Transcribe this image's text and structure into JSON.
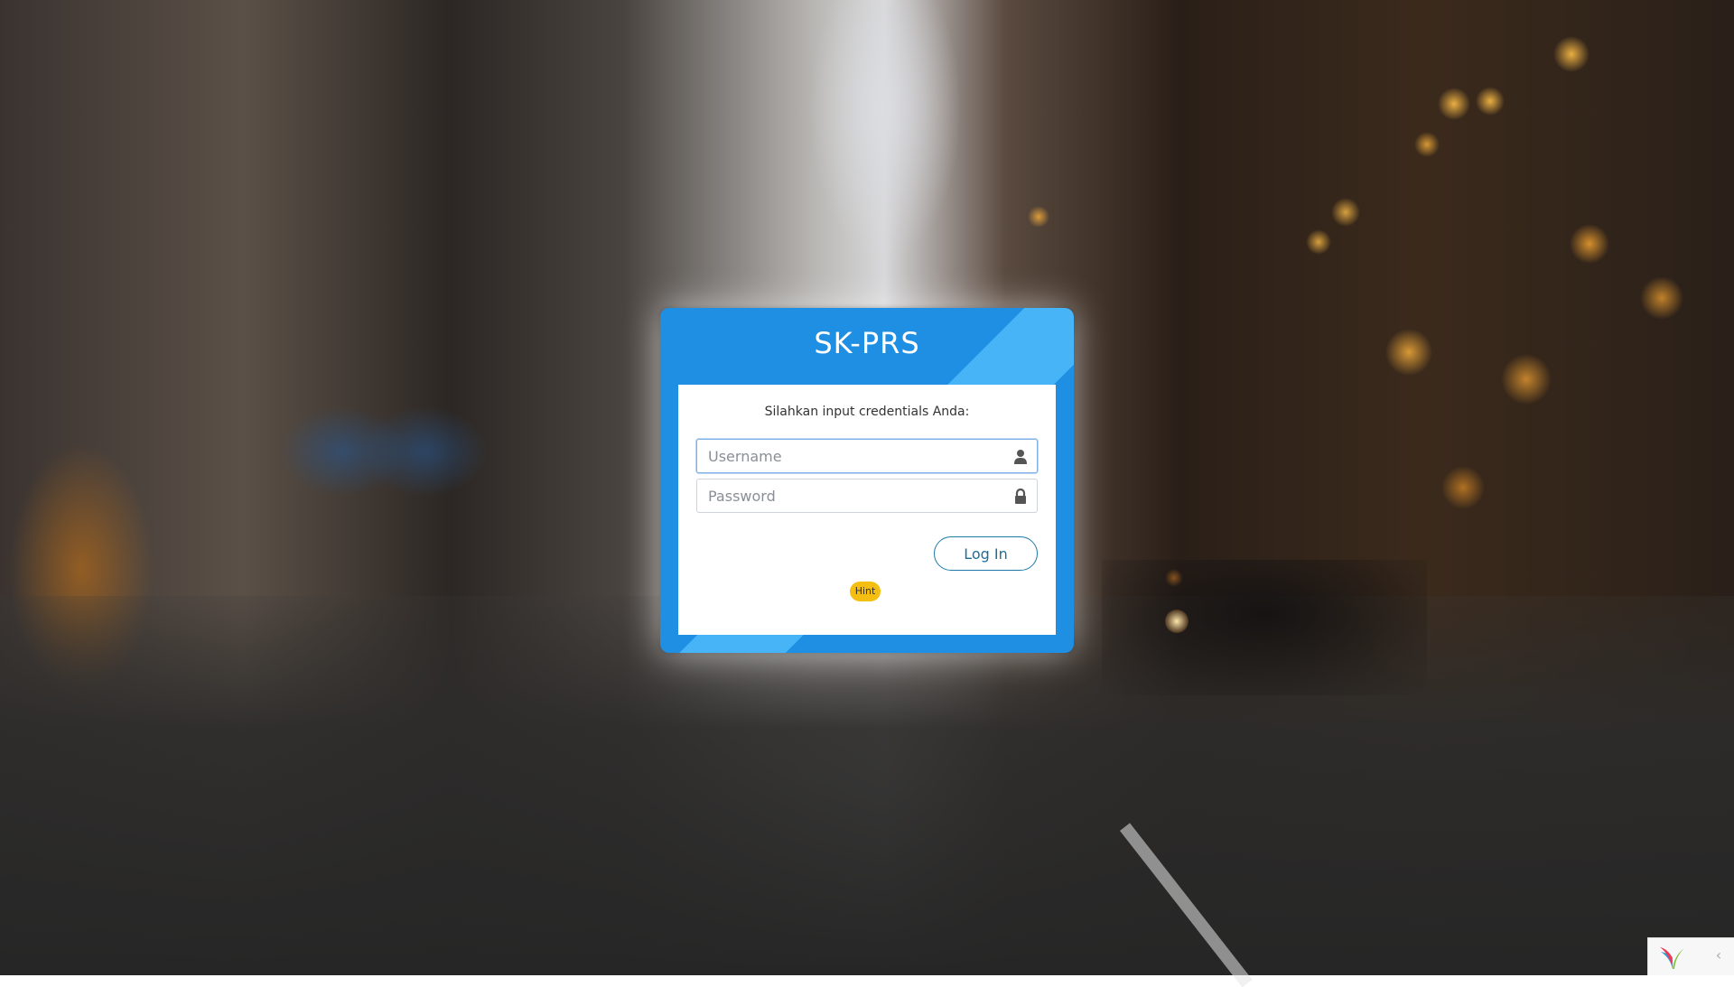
{
  "app": {
    "title": "SK-PRS"
  },
  "login": {
    "prompt": "Silahkan input credentials Anda:",
    "username": {
      "placeholder": "Username",
      "value": "",
      "icon": "user-icon"
    },
    "password": {
      "placeholder": "Password",
      "value": "",
      "icon": "lock-icon"
    },
    "login_button_label": "Log In",
    "hint_label": "Hint"
  },
  "debug_toolbar": {
    "logo_icon": "framework-logo-icon",
    "toggle_label": "‹"
  },
  "colors": {
    "card_primary": "#1f8fe4",
    "card_accent": "#46b4f6",
    "button_border": "#1e7aa8",
    "hint_badge": "#f4bf12"
  }
}
